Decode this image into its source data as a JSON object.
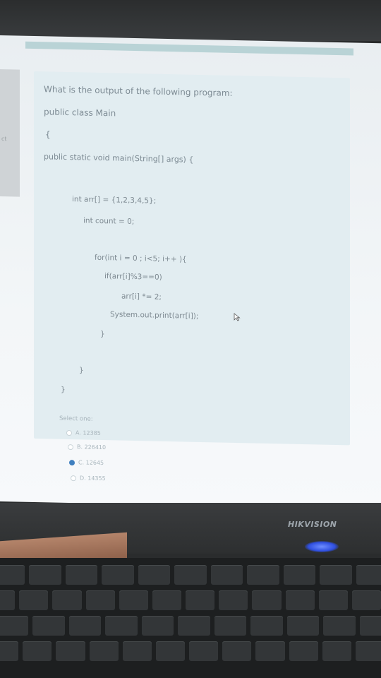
{
  "question": {
    "prompt": "What is the output of the following program:",
    "line_class": "public class Main",
    "open_brace_1": "{",
    "line_main": "public static void main(String[] args) {",
    "line_arr": "int arr[] = {1,2,3,4,5};",
    "line_count": "int count = 0;",
    "line_for": "for(int i = 0 ; i<5; i++ ){",
    "line_if": "if(arr[i]%3==0)",
    "line_mult": "arr[i] *= 2;",
    "line_print": "System.out.print(arr[i]);",
    "close_brace_1": "}",
    "close_brace_2": "}",
    "close_brace_3": "}"
  },
  "answer": {
    "select_label": "Select one:",
    "options": [
      {
        "label": "A. 12385",
        "selected": false
      },
      {
        "label": "B. 226410",
        "selected": false
      },
      {
        "label": "C. 12645",
        "selected": true
      },
      {
        "label": "D. 14355",
        "selected": false
      }
    ]
  },
  "sidebar": {
    "fragment": "ct"
  },
  "monitor": {
    "brand": "HIKVISION"
  },
  "colors": {
    "accent": "#3f7fbf",
    "panel": "#e2edf1",
    "led": "#2f4fe0"
  }
}
